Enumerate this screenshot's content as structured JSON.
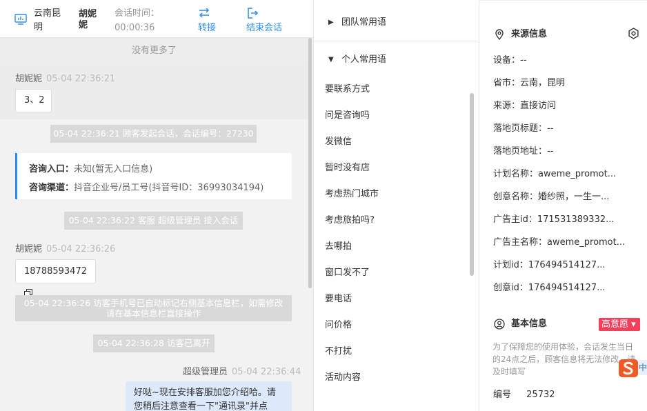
{
  "header": {
    "location": "云南昆明",
    "visitor_name": "胡妮妮",
    "session_time_label": "会话时间：",
    "session_time": "00:00:36",
    "transfer_label": "转接",
    "end_label": "结束会话"
  },
  "chat": {
    "no_more": "没有更多了",
    "msg1": {
      "sender": "胡妮妮",
      "time": "05-04 22:36:21",
      "text": "3、2"
    },
    "sys1": "05-04 22:36:21 顾客发起会话，会话编号：27230",
    "info_card": {
      "entry_label": "咨询入口：",
      "entry_value": "未知(暂无入口信息)",
      "channel_label": "咨询渠道：",
      "channel_value": "抖音企业号/员工号(抖音号ID：36993034194)"
    },
    "sys2": "05-04 22:36:22 客服 超级管理员 接入会话",
    "msg2": {
      "sender": "胡妮妮",
      "time": "05-04 22:36:26",
      "text": "18788593472"
    },
    "sys3_line1": "05-04 22:36:26 访客手机号已自动标记右侧基本信息栏，如需修改",
    "sys3_line2": "请在基本信息栏直接操作",
    "sys4": "05-04 22:36:28 访客已离开",
    "msg3": {
      "sender": "超级管理员",
      "time": "05-04 22:36:44",
      "text": "好哒~现在安排客服加您介绍哈。请您稍后注意查看一下\"通讯录\"并点"
    }
  },
  "phrases": {
    "team_label": "团队常用语",
    "personal_label": "个人常用语",
    "items": [
      "要联系方式",
      "问是咨询吗",
      "发微信",
      "暂时没有店",
      "考虑热门城市",
      "考虑旅拍吗?",
      "去哪拍",
      "窗口发不了",
      "要电话",
      "问价格",
      "不打扰",
      "活动内容"
    ]
  },
  "source": {
    "title": "来源信息",
    "fields": [
      "设备：--",
      "省市：云南，昆明",
      "来源：直接访问",
      "落地页标题：--",
      "落地页地址：--",
      "计划名称：aweme_promot...",
      "创意名称：婚纱照，一生一...",
      "广告主id：171531389332...",
      "广告主名称：aweme_promot...",
      "计划id：176494514127...",
      "创意id：176494514127..."
    ]
  },
  "basic": {
    "title": "基本信息",
    "intent_badge": "高意愿 ▾",
    "notice": "为了保障您的使用体验，会话发生当日的24点之后，顾客信息将无法修改，请及时填写",
    "id_label": "编号",
    "id_value": "25732",
    "ime_tail": "中"
  },
  "colors": {
    "accent": "#2d8cf0",
    "badge": "#f5405b",
    "agent_bubble": "#dce9fb"
  }
}
